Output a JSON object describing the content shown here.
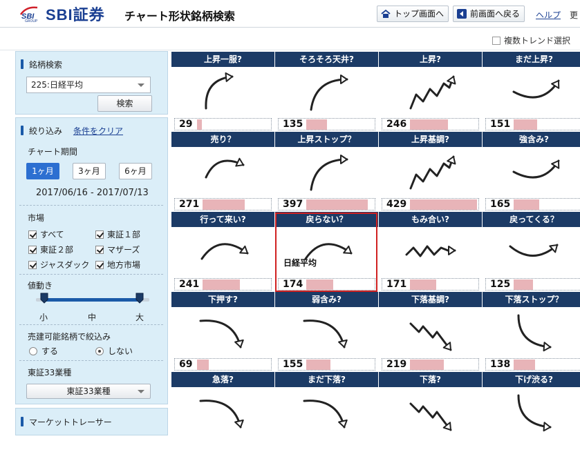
{
  "header": {
    "brand": "SBI証券",
    "brand_mark": "SBI GROUP",
    "title": "チャート形状銘柄検索",
    "top_button": "トップ画面へ",
    "back_button": "前画面へ戻る",
    "help_link": "ヘルプ",
    "more_link": "更"
  },
  "options": {
    "multi_trend": "複数トレンド選択"
  },
  "search_panel": {
    "title": "銘柄検索",
    "selected_index": "225:日経平均",
    "search_button": "検索"
  },
  "filter_panel": {
    "title": "絞り込み",
    "clear_link": "条件をクリア",
    "period_label": "チャート期間",
    "periods": [
      "1ヶ月",
      "3ヶ月",
      "6ヶ月"
    ],
    "active_period": 0,
    "date_range": "2017/06/16 - 2017/07/13",
    "market_label": "市場",
    "markets": [
      "すべて",
      "東証１部",
      "東証２部",
      "マザーズ",
      "ジャスダック",
      "地方市場"
    ],
    "price_move_label": "値動き",
    "price_scale": [
      "小",
      "中",
      "大"
    ],
    "tradable_label": "売建可能銘柄で絞込み",
    "tradable_options": [
      "する",
      "しない"
    ],
    "tradable_selected": 1,
    "sector_label": "東証33業種",
    "sector_select": "東証33業種"
  },
  "tracer_panel": {
    "title": "マーケットトレーサー"
  },
  "grid": {
    "index_label": "日経平均",
    "selected_cell": 9,
    "cells": [
      {
        "label": "上昇一服?",
        "count": 29,
        "shape": "up-then-flat"
      },
      {
        "label": "そろそろ天井?",
        "count": 135,
        "shape": "rise-curve"
      },
      {
        "label": "上昇?",
        "count": 246,
        "shape": "zigzag-up"
      },
      {
        "label": "まだ上昇?",
        "count": 151,
        "shape": "flat-then-up"
      },
      {
        "label": "売り？",
        "count": 271,
        "shape": "arc-right"
      },
      {
        "label": "上昇ストップ？",
        "count": 397,
        "shape": "rise-curve"
      },
      {
        "label": "上昇基調?",
        "count": 429,
        "shape": "zigzag-up"
      },
      {
        "label": "強含み?",
        "count": 165,
        "shape": "flat-then-up"
      },
      {
        "label": "行って来い?",
        "count": 241,
        "shape": "arc-down"
      },
      {
        "label": "戻らない？",
        "count": 174,
        "shape": "arc-down"
      },
      {
        "label": "もみ合い?",
        "count": 171,
        "shape": "zigzag-flat"
      },
      {
        "label": "戻ってくる？",
        "count": 125,
        "shape": "valley"
      },
      {
        "label": "下押す?",
        "count": 69,
        "shape": "fall-curve"
      },
      {
        "label": "弱含み?",
        "count": 155,
        "shape": "fall-curve"
      },
      {
        "label": "下落基調?",
        "count": 219,
        "shape": "zigzag-down"
      },
      {
        "label": "下落ストップ？",
        "count": 138,
        "shape": "down-then-flat"
      },
      {
        "label": "急落?",
        "count": null,
        "shape": "fall-curve"
      },
      {
        "label": "まだ下落?",
        "count": null,
        "shape": "fall-curve"
      },
      {
        "label": "下落?",
        "count": null,
        "shape": "zigzag-down"
      },
      {
        "label": "下げ渋る?",
        "count": null,
        "shape": "down-then-flat"
      }
    ]
  },
  "colors": {
    "accent": "#1c3b66",
    "bar": "#e8b4b8",
    "highlight": "#d02020",
    "panel": "#dbeef8"
  }
}
